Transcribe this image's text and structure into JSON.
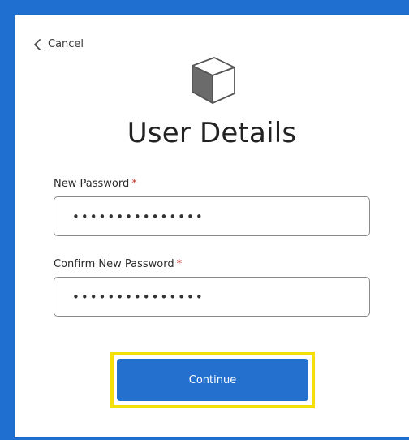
{
  "nav": {
    "cancel_label": "Cancel",
    "cancel_icon": "chevron-left-icon"
  },
  "logo": {
    "icon": "cube-icon"
  },
  "page": {
    "title": "User Details"
  },
  "form": {
    "new_password": {
      "label": "New Password",
      "required_mark": "*",
      "value": "•••••••••••••••"
    },
    "confirm_password": {
      "label": "Confirm New Password",
      "required_mark": "*",
      "value": "•••••••••••••••"
    },
    "continue_label": "Continue"
  },
  "colors": {
    "background": "#1f6fd1",
    "button": "#2370cf",
    "highlight": "#f5df0b",
    "required": "#c23934"
  }
}
